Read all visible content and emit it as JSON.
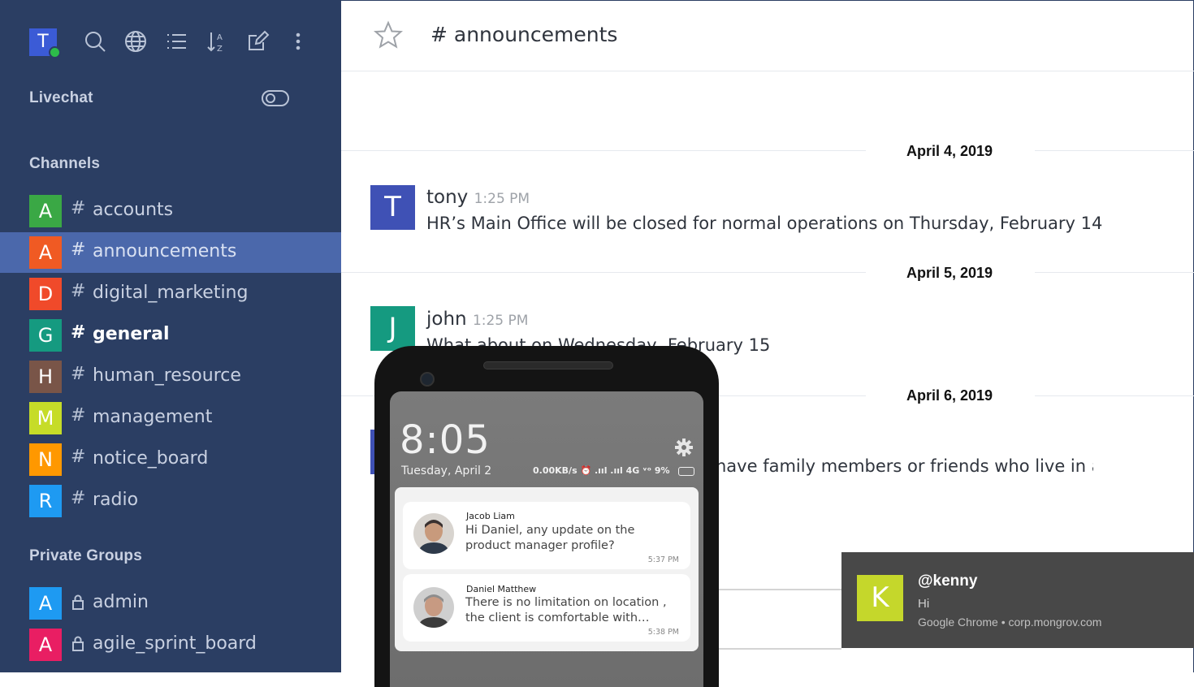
{
  "sidebar": {
    "user_initial": "T",
    "livechat_label": "Livechat",
    "channels_label": "Channels",
    "private_groups_label": "Private Groups",
    "channels": [
      {
        "initial": "A",
        "name": "accounts",
        "color": "#3aa845"
      },
      {
        "initial": "A",
        "name": "announcements",
        "color": "#f05a23"
      },
      {
        "initial": "D",
        "name": "digital_marketing",
        "color": "#f04a2a"
      },
      {
        "initial": "G",
        "name": "general",
        "color": "#159a80"
      },
      {
        "initial": "H",
        "name": "human_resource",
        "color": "#795548"
      },
      {
        "initial": "M",
        "name": "management",
        "color": "#c6dc28"
      },
      {
        "initial": "N",
        "name": "notice_board",
        "color": "#ff9800"
      },
      {
        "initial": "R",
        "name": "radio",
        "color": "#1e9af2"
      }
    ],
    "private_groups": [
      {
        "initial": "A",
        "name": "admin",
        "color": "#1e9af2"
      },
      {
        "initial": "A",
        "name": "agile_sprint_board",
        "color": "#e91e63"
      }
    ]
  },
  "room": {
    "title": "# announcements"
  },
  "messages": [
    {
      "date": "April 4, 2019",
      "initial": "T",
      "user": "tony",
      "time": "1:25 PM",
      "text": "HR’s Main Office will be closed for normal operations on Thursday, February 14",
      "color": "#3f51b5"
    },
    {
      "date": "April 5, 2019",
      "initial": "J",
      "user": "john",
      "time": "1:25 PM",
      "text": "What about on Wednesday, February 15",
      "color": "#159a80"
    },
    {
      "date": "April 6, 2019",
      "text": "have family members or friends who live in area"
    }
  ],
  "phone": {
    "time": "8:05",
    "date": "Tuesday, April 2",
    "status": "0.00KB/s ⏰ .ııl .ııl 4G ᵛᵒ 9%",
    "notifications": [
      {
        "name": "Jacob Liam",
        "text": "Hi Daniel, any update on the product manager profile?",
        "time": "5:37 PM"
      },
      {
        "name": "Daniel Matthew",
        "text": "There is no limitation on location , the client is comfortable with…",
        "time": "5:38 PM"
      }
    ]
  },
  "toast": {
    "initial": "K",
    "title": "@kenny",
    "body": "Hi",
    "source": "Google Chrome • corp.mongrov.com"
  }
}
